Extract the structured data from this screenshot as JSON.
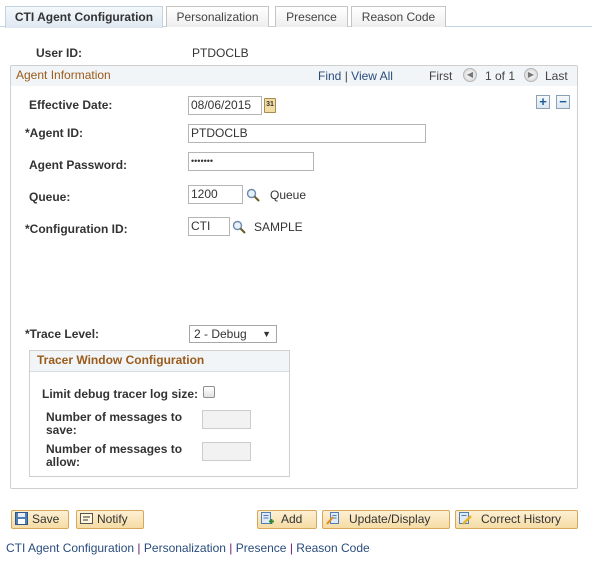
{
  "tabs": [
    {
      "label": "CTI Agent Configuration",
      "active": true
    },
    {
      "label": "Personalization",
      "active": false
    },
    {
      "label": "Presence",
      "active": false
    },
    {
      "label": "Reason Code",
      "active": false
    }
  ],
  "user_id": {
    "label": "User ID:",
    "value": "PTDOCLB"
  },
  "group": {
    "title": "Agent Information",
    "find": "Find",
    "separator": "|",
    "view_all": "View All",
    "first": "First",
    "count": "1 of 1",
    "last": "Last",
    "add_row": "+",
    "delete_row": "−"
  },
  "fields": {
    "effective_date": {
      "label": "Effective Date:",
      "value": "08/06/2015",
      "calendar_text": "31"
    },
    "agent_id": {
      "label": "*Agent ID:",
      "value": "PTDOCLB"
    },
    "agent_password": {
      "label": "Agent Password:",
      "value": "•••••••"
    },
    "queue": {
      "label": "Queue:",
      "value": "1200",
      "description": "Queue"
    },
    "configuration_id": {
      "label": "*Configuration ID:",
      "value": "CTI",
      "description": "SAMPLE"
    },
    "trace_level": {
      "label": "*Trace Level:",
      "value": "2 - Debug",
      "arrow": "▼"
    }
  },
  "tracer": {
    "title": "Tracer Window Configuration",
    "limit_label": "Limit debug tracer log size:",
    "limit_checked": false,
    "save_label_1": "Number of messages to",
    "save_label_2": "save:",
    "save_value": "",
    "allow_label_1": "Number of messages to",
    "allow_label_2": "allow:",
    "allow_value": ""
  },
  "buttons": {
    "save": "Save",
    "notify": "Notify",
    "add": "Add",
    "update_display": "Update/Display",
    "correct_history": "Correct History"
  },
  "footer_links": [
    "CTI Agent Configuration",
    "Personalization",
    "Presence",
    "Reason Code"
  ],
  "footer_separator": "|",
  "colors": {
    "group_title": "#9b5a1a",
    "link": "#2a4c7d",
    "button_bg": "#f6dca4",
    "button_border": "#d6a85b"
  }
}
